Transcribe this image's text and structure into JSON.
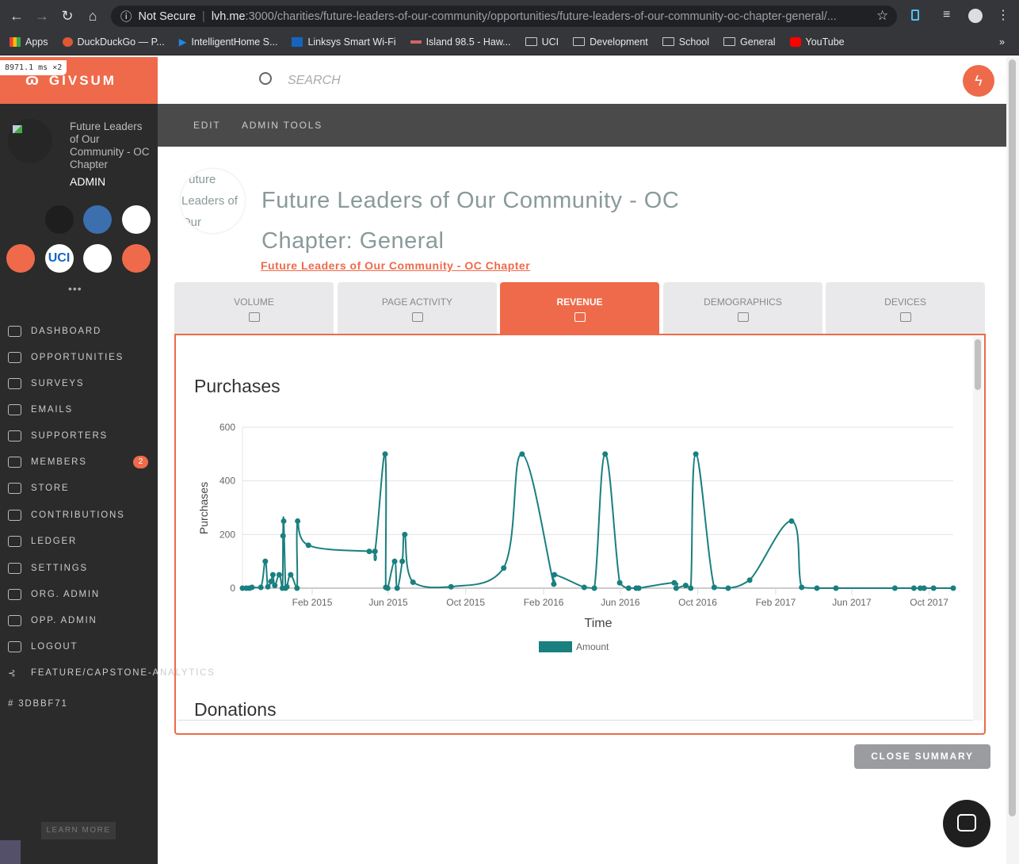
{
  "browser": {
    "security": "Not Secure",
    "url_host": "lvh.me",
    "url_rest": ":3000/charities/future-leaders-of-our-community/opportunities/future-leaders-of-our-community-oc-chapter-general/...",
    "bookmarks": [
      "Apps",
      "DuckDuckGo — P...",
      "IntelligentHome S...",
      "Linksys Smart Wi-Fi",
      "Island 98.5 - Haw...",
      "UCI",
      "Development",
      "School",
      "General",
      "YouTube"
    ],
    "perf_badge": "8971.1 ms ×2"
  },
  "sidebar": {
    "logo": "GIVSUM",
    "org_name": "Future Leaders of Our Community - OC Chapter",
    "role": "ADMIN",
    "org_icons": [
      "#2b2b2b",
      "#1e1e1e",
      "#3b6fae",
      "#ffffff",
      "#ef6a4a",
      "#ffffff",
      "#ffffff",
      "#ef6a4a"
    ],
    "org_icon_labels": [
      "",
      "",
      "",
      "",
      "",
      "UCI",
      "",
      ""
    ],
    "more": "•••",
    "items": [
      {
        "label": "DASHBOARD",
        "icon": "dashboard-icon"
      },
      {
        "label": "OPPORTUNITIES",
        "icon": "building-icon"
      },
      {
        "label": "SURVEYS",
        "icon": "question-icon"
      },
      {
        "label": "EMAILS",
        "icon": "mail-icon"
      },
      {
        "label": "SUPPORTERS",
        "icon": "people-icon"
      },
      {
        "label": "MEMBERS",
        "icon": "people-icon",
        "badge": "2"
      },
      {
        "label": "STORE",
        "icon": "cart-icon"
      },
      {
        "label": "CONTRIBUTIONS",
        "icon": "hand-icon"
      },
      {
        "label": "LEDGER",
        "icon": "card-icon"
      },
      {
        "label": "SETTINGS",
        "icon": "gear-icon"
      },
      {
        "label": "ORG. ADMIN",
        "icon": "cloud-icon"
      },
      {
        "label": "OPP. ADMIN",
        "icon": "cloud-icon"
      },
      {
        "label": "LOGOUT",
        "icon": "logout-icon"
      }
    ],
    "branch": "FEATURE/CAPSTONE-ANALYTICS",
    "commit": "# 3DBBF71",
    "learn_more": "LEARN MORE"
  },
  "header": {
    "search_placeholder": "SEARCH"
  },
  "subnav": {
    "items": [
      "EDIT",
      "ADMIN TOOLS"
    ]
  },
  "opportunity": {
    "avatar_alt": "Future Leaders of Our",
    "title": "Future Leaders of Our Community - OC Chapter: General",
    "org_link": "Future Leaders of Our Community - OC Chapter"
  },
  "tabs": [
    {
      "label": "VOLUME",
      "icon": "people-icon"
    },
    {
      "label": "PAGE ACTIVITY",
      "icon": "bar-chart-icon"
    },
    {
      "label": "REVENUE",
      "icon": "credit-card-icon",
      "active": true
    },
    {
      "label": "DEMOGRAPHICS",
      "icon": "globe-icon"
    },
    {
      "label": "DEVICES",
      "icon": "mobile-icon"
    }
  ],
  "sections": {
    "purchases": "Purchases",
    "donations": "Donations"
  },
  "close_summary": "CLOSE SUMMARY",
  "colors": {
    "accent": "#ef6a4a",
    "series": "#1a7f7f"
  },
  "chart_data": {
    "type": "line",
    "xlabel": "Time",
    "ylabel": "Purchases",
    "ylim": [
      0,
      600
    ],
    "xlim": [
      "2014-10-14",
      "2017-11-08"
    ],
    "yticks": [
      "0",
      "200",
      "400",
      "600"
    ],
    "xticks": [
      {
        "date": "2015-02-01",
        "label": "Feb 2015"
      },
      {
        "date": "2015-06-01",
        "label": "Jun 2015"
      },
      {
        "date": "2015-10-01",
        "label": "Oct 2015"
      },
      {
        "date": "2016-02-01",
        "label": "Feb 2016"
      },
      {
        "date": "2016-06-01",
        "label": "Jun 2016"
      },
      {
        "date": "2016-10-01",
        "label": "Oct 2016"
      },
      {
        "date": "2017-02-01",
        "label": "Feb 2017"
      },
      {
        "date": "2017-06-01",
        "label": "Jun 2017"
      },
      {
        "date": "2017-10-01",
        "label": "Oct 2017"
      }
    ],
    "grid": true,
    "legend": "bottom",
    "series": [
      {
        "name": "Amount",
        "points": [
          [
            "2014-10-14",
            0
          ],
          [
            "2014-10-20",
            0
          ],
          [
            "2014-10-25",
            0
          ],
          [
            "2014-10-29",
            3
          ],
          [
            "2014-11-12",
            3
          ],
          [
            "2014-11-19",
            100
          ],
          [
            "2014-11-23",
            5
          ],
          [
            "2014-11-28",
            25
          ],
          [
            "2014-12-01",
            50
          ],
          [
            "2014-12-04",
            10
          ],
          [
            "2014-12-11",
            50
          ],
          [
            "2014-12-16",
            0
          ],
          [
            "2014-12-17",
            195
          ],
          [
            "2014-12-18",
            250
          ],
          [
            "2014-12-21",
            0
          ],
          [
            "2014-12-23",
            5
          ],
          [
            "2014-12-29",
            50
          ],
          [
            "2015-01-08",
            0
          ],
          [
            "2015-01-09",
            250
          ],
          [
            "2015-01-26",
            160
          ],
          [
            "2015-05-02",
            137
          ],
          [
            "2015-05-11",
            137
          ],
          [
            "2015-05-27",
            500
          ],
          [
            "2015-05-28",
            3
          ],
          [
            "2015-05-31",
            0
          ],
          [
            "2015-06-11",
            100
          ],
          [
            "2015-06-15",
            0
          ],
          [
            "2015-06-23",
            100
          ],
          [
            "2015-06-27",
            200
          ],
          [
            "2015-07-10",
            22
          ],
          [
            "2015-09-08",
            5
          ],
          [
            "2015-11-30",
            75
          ],
          [
            "2015-12-29",
            500
          ],
          [
            "2016-02-17",
            15
          ],
          [
            "2016-02-18",
            50
          ],
          [
            "2016-04-05",
            3
          ],
          [
            "2016-04-21",
            0
          ],
          [
            "2016-05-08",
            500
          ],
          [
            "2016-05-31",
            20
          ],
          [
            "2016-06-14",
            0
          ],
          [
            "2016-06-26",
            0
          ],
          [
            "2016-06-30",
            0
          ],
          [
            "2016-08-25",
            20
          ],
          [
            "2016-08-28",
            0
          ],
          [
            "2016-09-12",
            10
          ],
          [
            "2016-09-20",
            0
          ],
          [
            "2016-09-28",
            500
          ],
          [
            "2016-10-27",
            3
          ],
          [
            "2016-11-18",
            0
          ],
          [
            "2016-12-22",
            30
          ],
          [
            "2017-02-26",
            250
          ],
          [
            "2017-03-14",
            3
          ],
          [
            "2017-04-07",
            0
          ],
          [
            "2017-05-07",
            0
          ],
          [
            "2017-08-08",
            0
          ],
          [
            "2017-09-07",
            0
          ],
          [
            "2017-09-17",
            0
          ],
          [
            "2017-09-23",
            0
          ],
          [
            "2017-10-08",
            0
          ],
          [
            "2017-11-08",
            0
          ]
        ]
      }
    ]
  }
}
